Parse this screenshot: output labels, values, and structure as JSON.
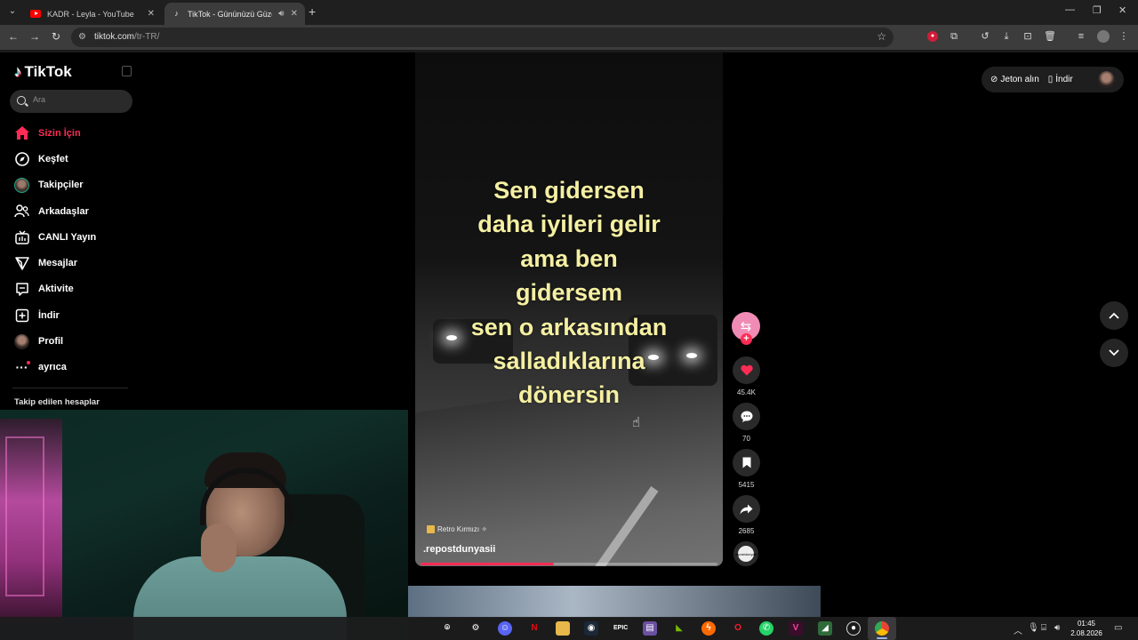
{
  "browser": {
    "tabs": [
      {
        "title": "KADR - Leyla - YouTube",
        "active": false
      },
      {
        "title": "TikTok - Gününüzü Güzelleştirecek",
        "active": true
      }
    ],
    "url_domain": "tiktok.com",
    "url_path": "/tr-TR/"
  },
  "tiktok": {
    "logo_text": "TikTok",
    "search_placeholder": "Ara",
    "nav": [
      {
        "label": "Sizin İçin",
        "icon": "home-icon",
        "active": true
      },
      {
        "label": "Keşfet",
        "icon": "compass-icon",
        "active": false
      },
      {
        "label": "Takipçiler",
        "icon": "avatar",
        "active": false
      },
      {
        "label": "Arkadaşlar",
        "icon": "friends-icon",
        "active": false
      },
      {
        "label": "CANLI Yayın",
        "icon": "live-icon",
        "active": false
      },
      {
        "label": "Mesajlar",
        "icon": "send-icon",
        "active": false
      },
      {
        "label": "Aktivite",
        "icon": "activity-icon",
        "active": false
      },
      {
        "label": "İndir",
        "icon": "download-icon",
        "active": false
      },
      {
        "label": "Profil",
        "icon": "avatar",
        "active": false
      },
      {
        "label": "ayrıca",
        "icon": "more-icon",
        "active": false
      }
    ],
    "followed_heading": "Takip edilen hesaplar",
    "top_buttons": {
      "coins": "Jeton alın",
      "download": "İndir"
    },
    "video": {
      "caption_lines": [
        "Sen gidersen",
        "daha iyileri gelir",
        "ama ben",
        "gidersem",
        "sen o arkasından",
        "salladıklarına",
        "dönersin"
      ],
      "music_label": "Retro Kırmızı ✧",
      "author": ".repostdunyasii",
      "progress": 0.45
    },
    "actions": {
      "likes": "45.4K",
      "comments": "70",
      "saves": "5415",
      "shares": "2685",
      "disc_label": "repostdunyasi"
    }
  },
  "taskbar": {
    "time": "01:45",
    "date": "2.08.2026"
  },
  "colors": {
    "brand": "#fe2c55",
    "caption": "#f5f0a2",
    "background": "#000000"
  }
}
